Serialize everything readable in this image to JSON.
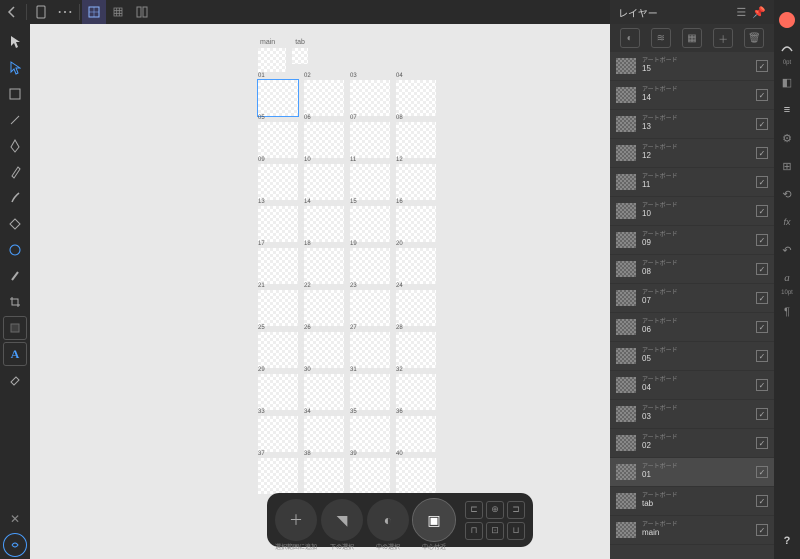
{
  "topbar": {
    "back": "←",
    "doc": "📄",
    "menu": "⋯"
  },
  "header_artboards": [
    "main",
    "tab"
  ],
  "artboard_numbers": [
    "01",
    "02",
    "03",
    "04",
    "05",
    "06",
    "07",
    "08",
    "09",
    "10",
    "11",
    "12",
    "13",
    "14",
    "15",
    "16",
    "17",
    "18",
    "19",
    "20",
    "21",
    "22",
    "23",
    "24",
    "25",
    "26",
    "27",
    "28",
    "29",
    "30",
    "31",
    "32",
    "33",
    "34",
    "35",
    "36",
    "37",
    "38",
    "39",
    "40"
  ],
  "selected_artboard": "01",
  "layers_panel": {
    "title": "レイヤー",
    "item_type_label": "アートボード",
    "items": [
      {
        "name": "15"
      },
      {
        "name": "14"
      },
      {
        "name": "13"
      },
      {
        "name": "12"
      },
      {
        "name": "11"
      },
      {
        "name": "10"
      },
      {
        "name": "09"
      },
      {
        "name": "08"
      },
      {
        "name": "07"
      },
      {
        "name": "06"
      },
      {
        "name": "05"
      },
      {
        "name": "04"
      },
      {
        "name": "03"
      },
      {
        "name": "02"
      },
      {
        "name": "01",
        "selected": true
      },
      {
        "name": "tab"
      },
      {
        "name": "main"
      }
    ]
  },
  "right_rail": {
    "stroke_label": "0pt",
    "text_label": "10pt"
  },
  "contextbar": {
    "add": "＋",
    "labels": {
      "add_to_sel": "選択範囲に追加",
      "sel_below": "下の選択",
      "sel_inside": "中の選択",
      "snap_center": "中心付近"
    }
  },
  "help": "?"
}
